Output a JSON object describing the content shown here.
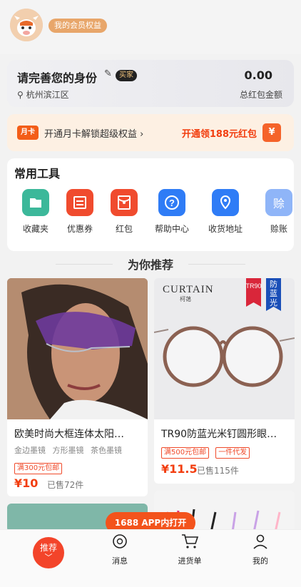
{
  "header": {
    "vip_label": "我的会员权益"
  },
  "identity": {
    "title": "请完善您的身份",
    "buyer_badge": "买家",
    "location": "杭州滨江区",
    "amount": "0.00",
    "amount_label": "总红包金额"
  },
  "month_card": {
    "badge": "月卡",
    "text": "开通月卡解锁超级权益 ›",
    "cta": "开通领188元红包"
  },
  "tools": {
    "heading": "常用工具",
    "items": [
      {
        "label": "收藏夹",
        "icon": "folder-icon",
        "color": "#3cb89a"
      },
      {
        "label": "优惠券",
        "icon": "coupon-icon",
        "color": "#f04b2e"
      },
      {
        "label": "红包",
        "icon": "red-packet-icon",
        "color": "#f04b2e"
      },
      {
        "label": "帮助中心",
        "icon": "help-icon",
        "color": "#2f7cf6"
      },
      {
        "label": "收货地址",
        "icon": "location-icon",
        "color": "#2f7cf6"
      },
      {
        "label": "赊账",
        "icon": "credit-icon",
        "color": "#8fb5f8"
      }
    ]
  },
  "recommend": {
    "title": "为你推荐"
  },
  "products": [
    {
      "name": "欧美时尚大框连体太阳…",
      "tags": [
        "金边墨镜",
        "方形墨镜",
        "茶色墨镜"
      ],
      "promos": [
        "满300元包邮"
      ],
      "price": "¥10",
      "sold": "已售72件"
    },
    {
      "name": "TR90防蓝光米钉圆形眼…",
      "tags": [],
      "promos": [
        "满500元包邮",
        "一件代发"
      ],
      "price": "¥11.5",
      "sold": "已售115件",
      "brand": "CURTAIN",
      "brand_sub": "柯蔼",
      "ribbon1": "TR90",
      "ribbon2": "防蓝光"
    }
  ],
  "app_open": "1688 APP内打开",
  "tabbar": {
    "home": "推荐",
    "messages": "消息",
    "cart": "进货单",
    "mine": "我的"
  }
}
